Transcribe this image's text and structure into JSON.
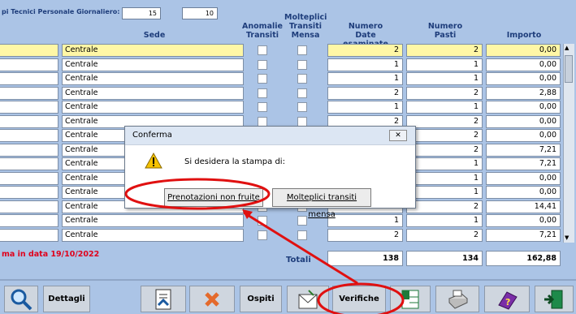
{
  "top_label": "pi Tecnici Personale Giornaliero:",
  "top_values": [
    "15",
    "10"
  ],
  "columns": {
    "sede": "Sede",
    "anomalie": "Anomalie Transiti",
    "molteplici": "Molteplici Transiti Mensa",
    "numero_date": "Numero Date esaminate",
    "numero_pasti": "Numero Pasti",
    "importo": "Importo"
  },
  "rows": [
    {
      "sede": "Centrale",
      "date": "2",
      "pasti": "2",
      "importo": "0,00"
    },
    {
      "sede": "Centrale",
      "date": "1",
      "pasti": "1",
      "importo": "0,00"
    },
    {
      "sede": "Centrale",
      "date": "1",
      "pasti": "1",
      "importo": "0,00"
    },
    {
      "sede": "Centrale",
      "date": "2",
      "pasti": "2",
      "importo": "2,88"
    },
    {
      "sede": "Centrale",
      "date": "1",
      "pasti": "1",
      "importo": "0,00"
    },
    {
      "sede": "Centrale",
      "date": "2",
      "pasti": "2",
      "importo": "0,00"
    },
    {
      "sede": "Centrale",
      "date": "",
      "pasti": "2",
      "importo": "0,00"
    },
    {
      "sede": "Centrale",
      "date": "",
      "pasti": "2",
      "importo": "7,21"
    },
    {
      "sede": "Centrale",
      "date": "",
      "pasti": "1",
      "importo": "7,21"
    },
    {
      "sede": "Centrale",
      "date": "",
      "pasti": "1",
      "importo": "0,00"
    },
    {
      "sede": "Centrale",
      "date": "",
      "pasti": "1",
      "importo": "0,00"
    },
    {
      "sede": "Centrale",
      "date": "",
      "pasti": "2",
      "importo": "14,41"
    },
    {
      "sede": "Centrale",
      "date": "1",
      "pasti": "1",
      "importo": "0,00"
    },
    {
      "sede": "Centrale",
      "date": "2",
      "pasti": "2",
      "importo": "7,21"
    }
  ],
  "status_text": "ma in data 19/10/2022",
  "totals": {
    "label": "Totali",
    "date": "138",
    "pasti": "134",
    "importo": "162,88"
  },
  "dialog": {
    "title": "Conferma",
    "message": "Si desidera la stampa di:",
    "button1": "Prenotazioni non fruite",
    "button2": "Molteplici transiti mensa",
    "close": "✕"
  },
  "toolbar": {
    "dettagli": "Dettagli",
    "ospiti": "Ospiti",
    "verifiche": "Verifiche dati"
  },
  "icons": [
    "search-icon",
    "dettagli",
    "report-icon",
    "delete-icon",
    "ospiti",
    "mail-icon",
    "verifiche",
    "excel-icon",
    "printer-icon",
    "help-book-icon",
    "exit-icon"
  ],
  "colors": {
    "background": "#abc4e6",
    "header_text": "#1e3d7b",
    "highlight_row": "#fff7a6",
    "status_red": "#e0001b",
    "annotation_red": "#e01010"
  }
}
